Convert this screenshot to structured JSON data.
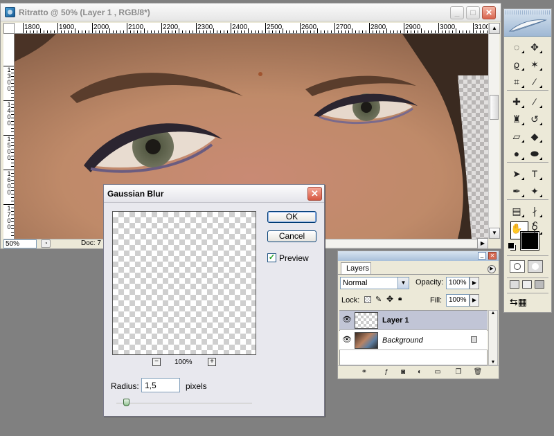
{
  "document": {
    "title": "Ritratto @ 50% (Layer 1 , RGB/8*)",
    "zoom": "50%",
    "doc_info": "Doc: 7",
    "ruler_top_labels": [
      "1800",
      "1900",
      "2000",
      "2100",
      "2200",
      "2300",
      "2400",
      "2500",
      "2600",
      "2700",
      "2800",
      "2900",
      "3000",
      "3100"
    ],
    "ruler_left_labels": [
      "1300",
      "1400",
      "1500",
      "1600",
      "1700"
    ],
    "buttons": {
      "minimize": "_",
      "maximize": "□",
      "close": "✕"
    }
  },
  "toolbox": {
    "tools": [
      {
        "name": "marquee-tool",
        "glyph": "◌"
      },
      {
        "name": "move-tool",
        "glyph": "✥"
      },
      {
        "name": "lasso-tool",
        "glyph": "ϱ"
      },
      {
        "name": "magic-wand-tool",
        "glyph": "✶"
      },
      {
        "name": "crop-tool",
        "glyph": "⌗"
      },
      {
        "name": "slice-tool",
        "glyph": "⁄"
      },
      {
        "name": "healing-brush-tool",
        "glyph": "✚"
      },
      {
        "name": "brush-tool",
        "glyph": "∕"
      },
      {
        "name": "clone-stamp-tool",
        "glyph": "♜"
      },
      {
        "name": "history-brush-tool",
        "glyph": "↺"
      },
      {
        "name": "eraser-tool",
        "glyph": "▱"
      },
      {
        "name": "paint-bucket-tool",
        "glyph": "◆"
      },
      {
        "name": "blur-tool",
        "glyph": "●"
      },
      {
        "name": "dodge-tool",
        "glyph": "⬬"
      },
      {
        "name": "path-selection-tool",
        "glyph": "➤"
      },
      {
        "name": "type-tool",
        "glyph": "T"
      },
      {
        "name": "pen-tool",
        "glyph": "✒"
      },
      {
        "name": "shape-tool",
        "glyph": "✦"
      },
      {
        "name": "notes-tool",
        "glyph": "▤"
      },
      {
        "name": "eyedropper-tool",
        "glyph": "∤"
      },
      {
        "name": "hand-tool",
        "glyph": "✋"
      },
      {
        "name": "zoom-tool",
        "glyph": "⚲"
      }
    ]
  },
  "layers_panel": {
    "tab": "Layers",
    "blend_mode": "Normal",
    "opacity_label": "Opacity:",
    "opacity_value": "100%",
    "lock_label": "Lock:",
    "fill_label": "Fill:",
    "fill_value": "100%",
    "layers": [
      {
        "name": "Layer 1",
        "selected": true
      },
      {
        "name": "Background",
        "locked": true
      }
    ]
  },
  "gaussian_blur": {
    "title": "Gaussian Blur",
    "ok": "OK",
    "cancel": "Cancel",
    "preview_label": "Preview",
    "preview_checked": true,
    "zoom": "100%",
    "zoom_out": "−",
    "zoom_in": "+",
    "radius_label": "Radius:",
    "radius_value": "1,5",
    "radius_unit": "pixels",
    "close": "✕"
  }
}
